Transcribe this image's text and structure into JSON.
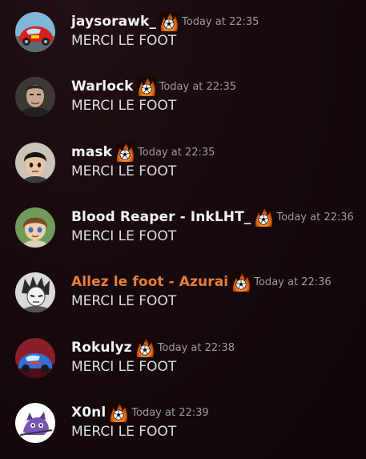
{
  "messages": [
    {
      "username": "jaysorawk_",
      "timestamp": "Today at 22:35",
      "content": "MERCI LE FOOT",
      "avatar": "red-race-car-avatar",
      "badge": "flame-ball-badge-icon"
    },
    {
      "username": "Warlock",
      "timestamp": "Today at 22:35",
      "content": "MERCI LE FOOT",
      "avatar": "portrait-man-avatar",
      "badge": "flame-ball-badge-icon"
    },
    {
      "username": "mask",
      "timestamp": "Today at 22:35",
      "content": "MERCI LE FOOT",
      "avatar": "anime-boy-avatar",
      "badge": "flame-ball-badge-icon"
    },
    {
      "username": "Blood Reaper - InkLHT_",
      "timestamp": "Today at 22:36",
      "content": "MERCI LE FOOT",
      "avatar": "anime-kid-avatar",
      "badge": "flame-ball-badge-icon"
    },
    {
      "username": "Allez le foot - Azurai",
      "timestamp": "Today at 22:36",
      "content": "MERCI LE FOOT",
      "avatar": "manga-character-avatar",
      "badge": "flame-ball-badge-icon",
      "name_color": "#e67e3c"
    },
    {
      "username": "Rokulyz",
      "timestamp": "Today at 22:38",
      "content": "MERCI LE FOOT",
      "avatar": "blue-race-car-avatar",
      "badge": "flame-ball-badge-icon"
    },
    {
      "username": "X0nl",
      "timestamp": "Today at 22:39",
      "content": "MERCI LE FOOT",
      "avatar": "purple-creature-avatar",
      "badge": "flame-ball-badge-icon"
    }
  ],
  "colors": {
    "background": "#170a0c",
    "username": "#f2f3f5",
    "role_orange": "#e67e3c",
    "timestamp": "#9a9ba1",
    "message_text": "#dbdee1"
  }
}
